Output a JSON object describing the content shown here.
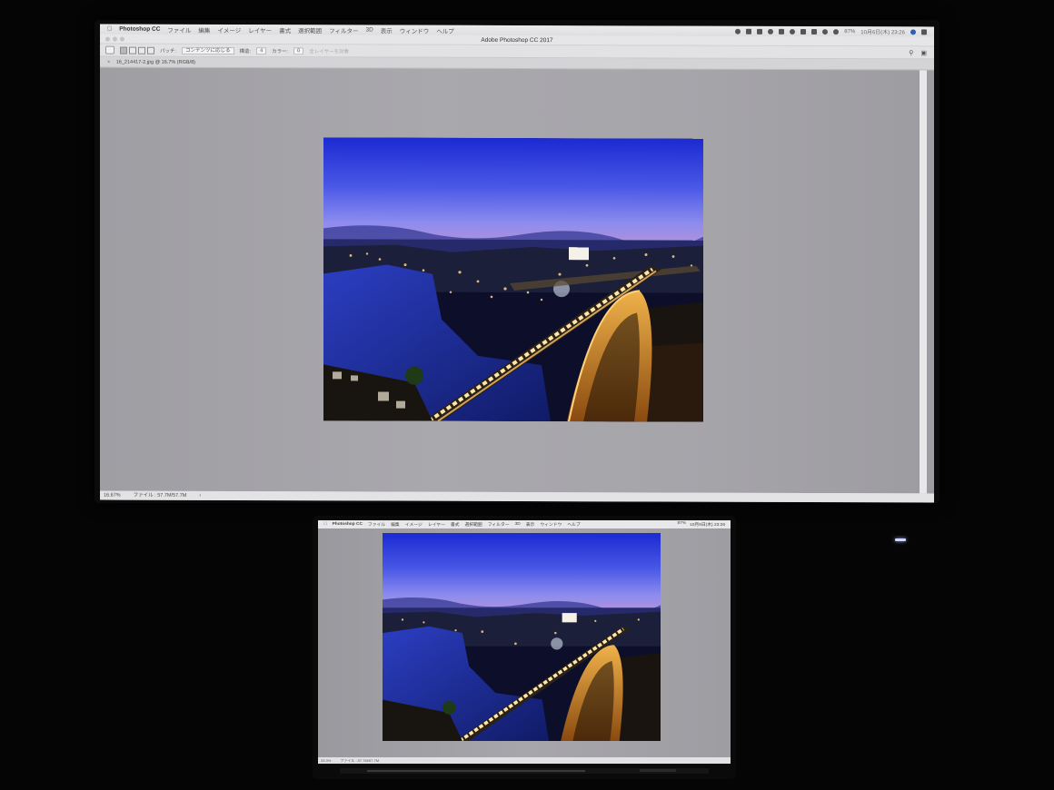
{
  "big_display": {
    "menubar": {
      "app_name": "Photoshop CC",
      "menus": [
        "ファイル",
        "編集",
        "イメージ",
        "レイヤー",
        "書式",
        "選択範囲",
        "フィルター",
        "3D",
        "表示",
        "ウィンドウ",
        "ヘルプ"
      ],
      "battery_percent": "87%",
      "clock": "10月6日(木) 23:26"
    },
    "window_title": "Adobe Photoshop CC 2017",
    "options_bar": {
      "patch_label": "パッチ:",
      "patch_mode": "コンテンツに応じる",
      "structure_label": "構造:",
      "structure_value": "4",
      "color_label": "カラー:",
      "color_value": "0",
      "sample_all": "全レイヤーを対象"
    },
    "document_tab": "16_214417-2.jpg @ 16.7% (RGB/8)",
    "status_bar": {
      "zoom": "16.67%",
      "file_size": "ファイル : 57.7M/57.7M"
    }
  },
  "laptop_display": {
    "menubar": {
      "app_name": "Photoshop CC",
      "menus": [
        "ファイル",
        "編集",
        "イメージ",
        "レイヤー",
        "書式",
        "選択範囲",
        "フィルター",
        "3D",
        "表示",
        "ウィンドウ",
        "ヘルプ"
      ],
      "battery_percent": "87%",
      "clock": "10月6日(木) 23:26"
    },
    "status_bar": {
      "zoom": "33.3%",
      "file_size": "ファイル : 57.7M/57.7M"
    }
  },
  "photo_subject": "night-bridge-over-river-city",
  "colors": {
    "sky_top": "#1d2fd8",
    "sky_horizon": "#8c8ef0",
    "river": "#1b2a9a",
    "bridge_lights": "#ffd27a",
    "canvas_gray": "#a6a5aa"
  }
}
